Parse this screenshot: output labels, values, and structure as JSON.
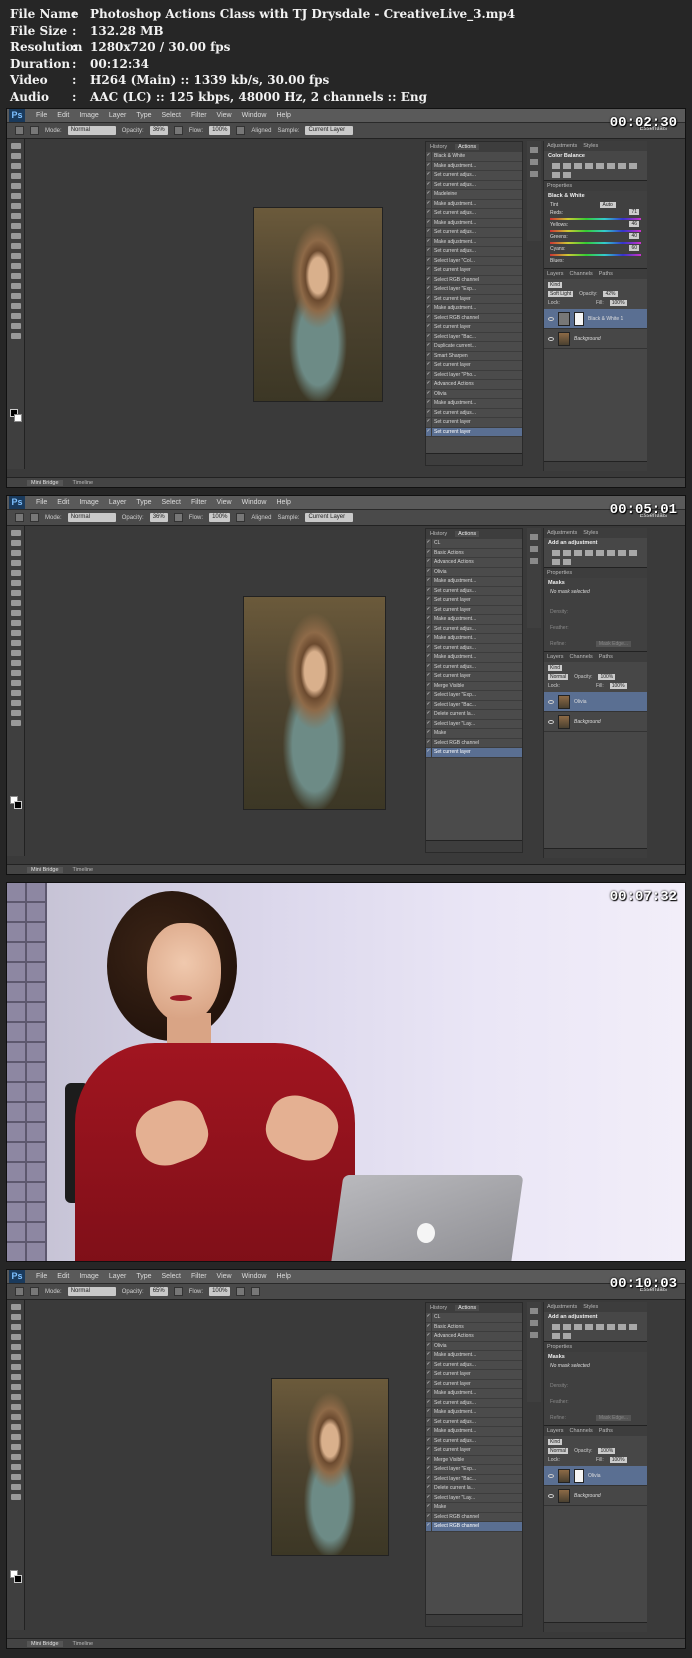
{
  "info": [
    {
      "key": "File Name",
      "sep": ":",
      "value": "Photoshop Actions Class with TJ Drysdale - CreativeLive_3.mp4"
    },
    {
      "key": "File Size",
      "sep": ":",
      "value": "132.28 MB"
    },
    {
      "key": "Resolution",
      "sep": ":",
      "value": "1280x720 / 30.00 fps"
    },
    {
      "key": "Duration",
      "sep": ":",
      "value": "00:12:34"
    },
    {
      "key": "Video",
      "sep": ":",
      "value": "H264 (Main) :: 1339 kb/s, 30.00 fps"
    },
    {
      "key": "Audio",
      "sep": ":",
      "value": "AAC (LC) :: 125 kbps, 48000 Hz, 2 channels :: Eng"
    }
  ],
  "frames": [
    {
      "timestamp": "00:02:30"
    },
    {
      "timestamp": "00:05:01"
    },
    {
      "timestamp": "00:07:32"
    },
    {
      "timestamp": "00:10:03"
    }
  ],
  "ps": {
    "logo": "Ps",
    "menu": [
      "File",
      "Edit",
      "Image",
      "Layer",
      "Type",
      "Select",
      "Filter",
      "View",
      "Window",
      "Help"
    ],
    "essentials": "Essentials",
    "mini_bridge": "Mini Bridge",
    "timeline": "Timeline",
    "panel_history": "History",
    "panel_actions": "Actions"
  },
  "f1": {
    "options": {
      "mode_label": "Mode:",
      "mode": "Normal",
      "opacity_label": "Opacity:",
      "opacity": "36%",
      "flow_label": "Flow:",
      "flow": "100%",
      "aligned": "Aligned",
      "sample_label": "Sample:",
      "sample": "Current Layer"
    },
    "actions": [
      "Black & White",
      "Make adjustment...",
      "Set current adjus...",
      "Set current adjus...",
      "Madeleine",
      "Make adjustment...",
      "Set current adjus...",
      "Make adjustment...",
      "Set current adjus...",
      "Make adjustment...",
      "Set current adjus...",
      "Select layer \"Col...",
      "Set current layer",
      "Select RGB channel",
      "Select layer \"Exp...",
      "Set current layer",
      "Make adjustment...",
      "Select RGB channel",
      "Set current layer",
      "Select layer \"Bac...",
      "Duplicate current...",
      "Smart Sharpen",
      "Set current layer",
      "Select layer \"Pho...",
      "Advanced Actions",
      "Olivia",
      "Make adjustment...",
      "Set current adjus...",
      "Set current layer",
      "Set current layer"
    ],
    "selected_action": 29,
    "adjustments_tab": "Adjustments",
    "styles_tab": "Styles",
    "adj_title": "Color Balance",
    "properties_tab": "Properties",
    "props_title": "Black & White",
    "tint": "Tint",
    "auto": "Auto",
    "sliders": [
      {
        "label": "Reds:",
        "value": "71"
      },
      {
        "label": "Yellows:",
        "value": "46"
      },
      {
        "label": "Greens:",
        "value": "40"
      },
      {
        "label": "Cyans:",
        "value": "60"
      },
      {
        "label": "Blues:",
        "value": ""
      }
    ],
    "layers_tabs": [
      "Layers",
      "Channels",
      "Paths"
    ],
    "kind": "Kind",
    "blend": "Soft Light",
    "opacity_label": "Opacity:",
    "opacity": "42%",
    "lock_label": "Lock:",
    "fill_label": "Fill:",
    "fill": "100%",
    "layers": [
      "Black & White 1",
      "Background"
    ]
  },
  "f2": {
    "options": {
      "mode_label": "Mode:",
      "mode": "Normal",
      "opacity_label": "Opacity:",
      "opacity": "36%",
      "flow_label": "Flow:",
      "flow": "100%",
      "aligned": "Aligned",
      "sample_label": "Sample:",
      "sample": "Current Layer"
    },
    "actions": [
      "CL",
      "Basic Actions",
      "Advanced Actions",
      "Olivia",
      "Make adjustment...",
      "Set current adjus...",
      "Set current layer",
      "Set current layer",
      "Make adjustment...",
      "Set current adjus...",
      "Make adjustment...",
      "Set current adjus...",
      "Make adjustment...",
      "Set current adjus...",
      "Set current layer",
      "Merge Visible",
      "Select layer \"Exp...",
      "Select layer \"Bac...",
      "Delete current la...",
      "Select layer \"Lay...",
      "Make",
      "Select RGB channel",
      "Set current layer"
    ],
    "selected_action": 22,
    "adjustments_tab": "Adjustments",
    "styles_tab": "Styles",
    "adj_title": "Add an adjustment",
    "properties_tab": "Properties",
    "masks_title": "Masks",
    "no_mask": "No mask selected",
    "density": "Density:",
    "feather": "Feather:",
    "refine": "Refine:",
    "mask_edge": "Mask Edge...",
    "layers_tabs": [
      "Layers",
      "Channels",
      "Paths"
    ],
    "kind": "Kind",
    "blend": "Normal",
    "opacity_label": "Opacity:",
    "opacity": "100%",
    "lock_label": "Lock:",
    "fill_label": "Fill:",
    "fill": "100%",
    "layers": [
      "Olivia",
      "Background"
    ]
  },
  "f4": {
    "options": {
      "mode_label": "Mode:",
      "mode": "Normal",
      "opacity_label": "Opacity:",
      "opacity": "65%",
      "flow_label": "Flow:",
      "flow": "100%"
    },
    "actions": [
      "CL",
      "Basic Actions",
      "Advanced Actions",
      "Olivia",
      "Make adjustment...",
      "Set current adjus...",
      "Set current layer",
      "Set current layer",
      "Make adjustment...",
      "Set current adjus...",
      "Make adjustment...",
      "Set current adjus...",
      "Make adjustment...",
      "Set current adjus...",
      "Set current layer",
      "Merge Visible",
      "Select layer \"Exp...",
      "Select layer \"Bac...",
      "Delete current la...",
      "Select layer \"Lay...",
      "Make",
      "Select RGB channel",
      "Select RGB channel"
    ],
    "selected_action": 22,
    "adjustments_tab": "Adjustments",
    "styles_tab": "Styles",
    "adj_title": "Add an adjustment",
    "properties_tab": "Properties",
    "masks_title": "Masks",
    "no_mask": "No mask selected",
    "density": "Density:",
    "feather": "Feather:",
    "refine": "Refine:",
    "mask_edge": "Mask Edge...",
    "layers_tabs": [
      "Layers",
      "Channels",
      "Paths"
    ],
    "kind": "Kind",
    "blend": "Normal",
    "opacity_label": "Opacity:",
    "opacity": "100%",
    "lock_label": "Lock:",
    "fill_label": "Fill:",
    "fill": "100%",
    "layers": [
      "Olivia",
      "Background"
    ]
  }
}
